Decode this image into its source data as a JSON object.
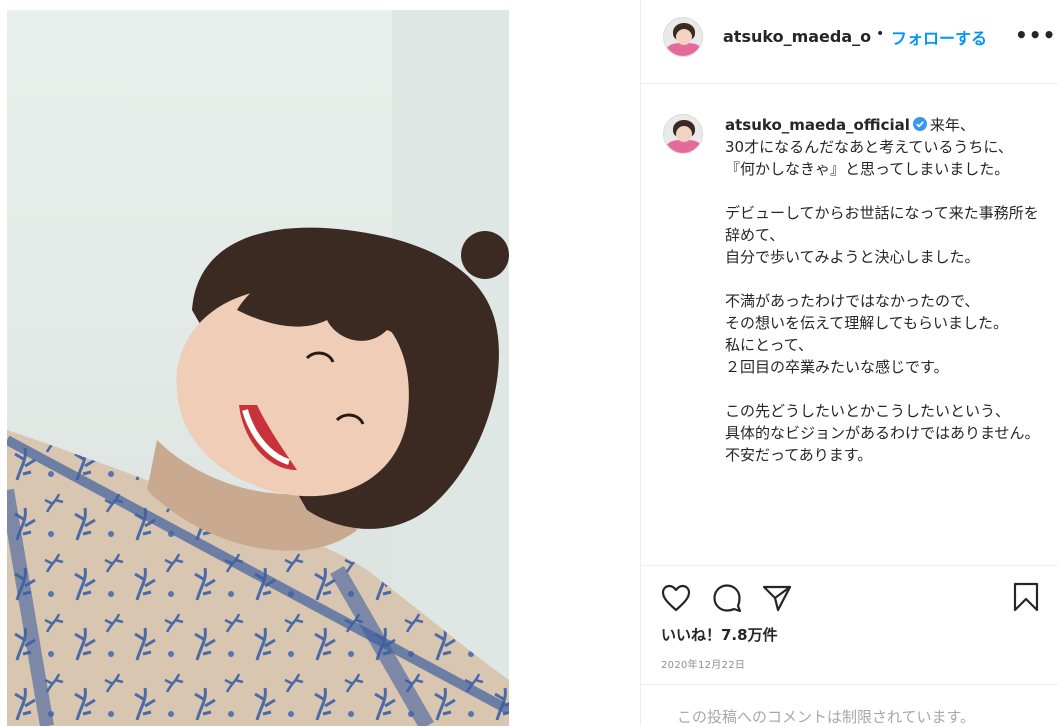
{
  "post": {
    "image_alt": "",
    "header": {
      "username": "atsuko_maeda_official",
      "dot": "•",
      "follow_label": "フォローする",
      "more_label": "•••"
    },
    "caption": {
      "username": "atsuko_maeda_official",
      "text": "来年、\n30才になるんだなあと考えているうちに、\n『何かしなきゃ』と思ってしまいました。\n\nデビューしてからお世話になって来た事務所を辞めて、\n自分で歩いてみようと決心しました。\n\n不満があったわけではなかったので、\nその想いを伝えて理解してもらいました。\n私にとって、\n２回目の卒業みたいな感じです。\n\nこの先どうしたいとかこうしたいという、\n具体的なビジョンがあるわけではありません。\n不安だってあります。"
    },
    "likes": "いいね！7.8万件",
    "date": "2020年12月22日",
    "comments_restricted": "この投稿へのコメントは制限されています。"
  },
  "icons": {
    "like": "heart-icon",
    "comment": "comment-icon",
    "share": "share-icon",
    "save": "bookmark-icon",
    "verified": "verified-badge-icon"
  },
  "colors": {
    "accent": "#0095f6",
    "verified": "#3897f0",
    "border": "#efefef",
    "muted": "#8e8e8e"
  }
}
